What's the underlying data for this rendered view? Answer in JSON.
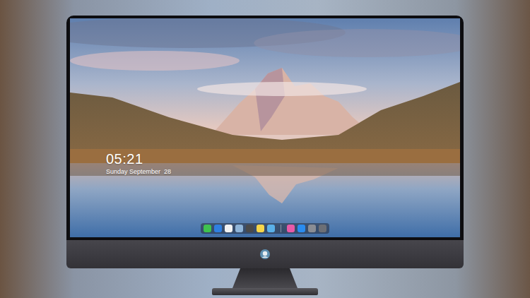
{
  "lockscreen": {
    "time": "05:21",
    "date": "Sunday September  28"
  },
  "dock": {
    "groups": [
      [
        {
          "color": "#3fc24f"
        },
        {
          "color": "#2f7fe0"
        },
        {
          "color": "#f2f2f2"
        },
        {
          "color": "#8fb4d8"
        },
        {
          "color": "#4a4a4a"
        },
        {
          "color": "#f6d64a"
        },
        {
          "color": "#5ab0e8"
        }
      ],
      [
        {
          "color": "#e85aa8"
        },
        {
          "color": "#2a8cf0"
        },
        {
          "color": "#8a8d94"
        },
        {
          "color": "#6c6f76"
        }
      ]
    ]
  }
}
